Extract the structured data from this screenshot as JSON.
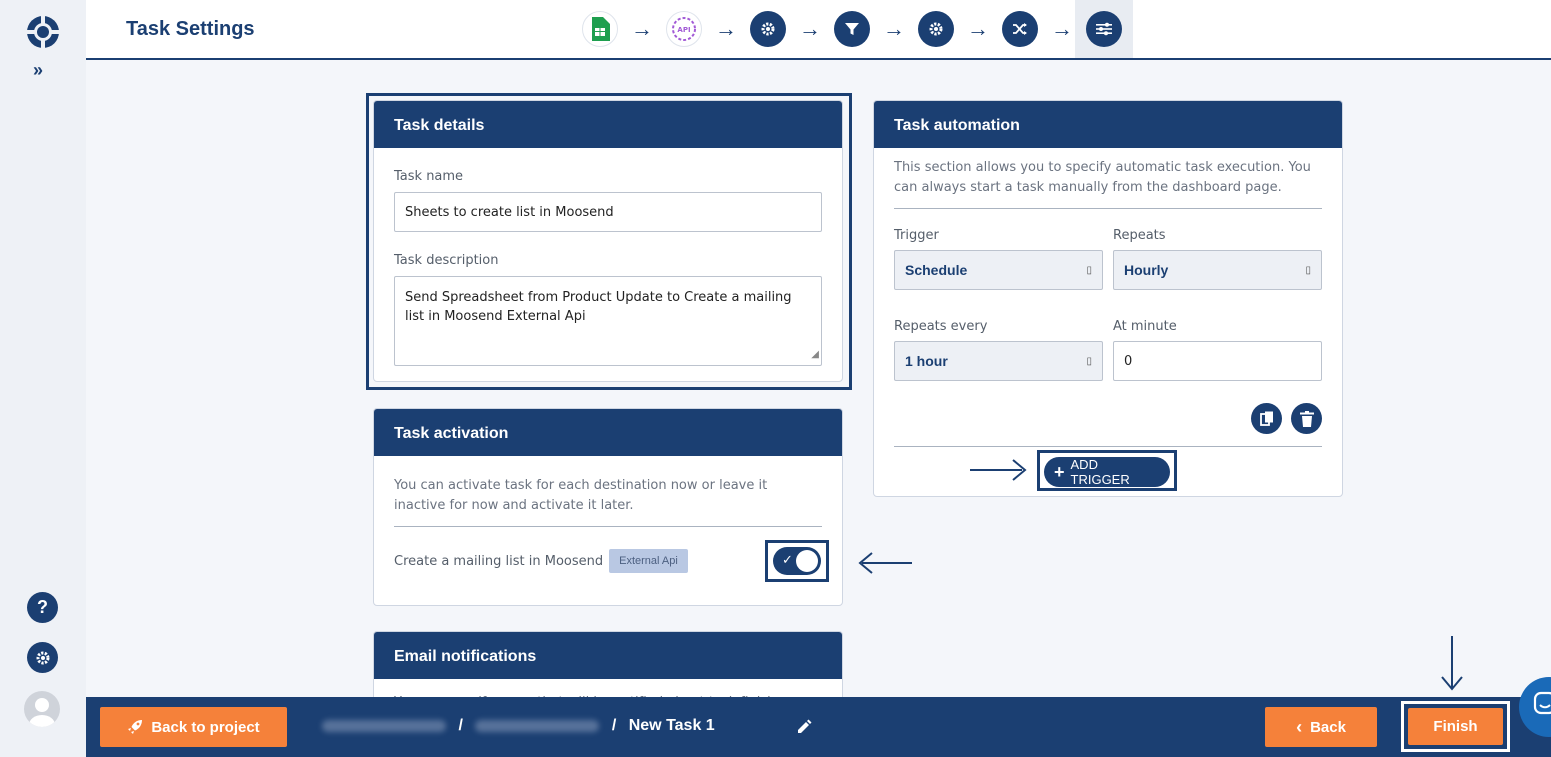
{
  "header": {
    "title": "Task Settings"
  },
  "task_details": {
    "title": "Task details",
    "name_label": "Task name",
    "name_value": "Sheets to create list in Moosend",
    "description_label": "Task description",
    "description_value": "Send Spreadsheet from Product Update to Create a mailing list in Moosend External Api"
  },
  "task_activation": {
    "title": "Task activation",
    "info": "You can activate task for each destination now or leave it inactive for now and activate it later.",
    "destination_label": "Create a mailing list in Moosend",
    "destination_badge": "External Api",
    "toggle_on": true
  },
  "email_notifications": {
    "title": "Email notifications",
    "info_partial": "You can specify users that will be notified about task finish..."
  },
  "task_automation": {
    "title": "Task automation",
    "info": "This section allows you to specify automatic task execution. You can always start a task manually from the dashboard page.",
    "trigger_label": "Trigger",
    "trigger_value": "Schedule",
    "repeats_label": "Repeats",
    "repeats_value": "Hourly",
    "repeats_every_label": "Repeats every",
    "repeats_every_value": "1 hour",
    "at_minute_label": "At minute",
    "at_minute_value": "0",
    "add_trigger_label": "ADD TRIGGER"
  },
  "footer": {
    "back_to_project": "Back to project",
    "separator": "/",
    "task_name": "New Task 1",
    "back": "Back",
    "finish": "Finish"
  },
  "colors": {
    "primary": "#1b3f72",
    "accent": "#f5813a",
    "background": "#f4f6fa"
  }
}
